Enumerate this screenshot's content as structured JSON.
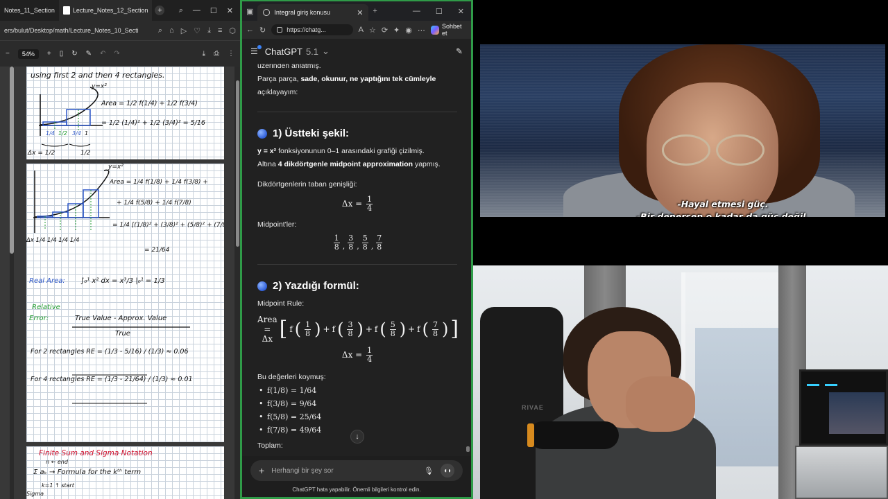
{
  "pdf_viewer": {
    "tabs": [
      {
        "label": "Notes_11_Section"
      },
      {
        "label": "Lecture_Notes_12_Section"
      }
    ],
    "address": "ers/bulut/Desktop/math/Lecture_Notes_10_Secti",
    "zoom": "54%",
    "page1": {
      "line1": "using first 2 and then 4 rectangles.",
      "curve_label": "y=x²",
      "area_eq1": "Area = 1/2 f(1/4) + 1/2 f(3/4)",
      "area_eq2": "= 1/2 (1/4)² + 1/2 (3/4)² = 5/16",
      "ticks": [
        "1/4",
        "1/2",
        "3/4",
        "1"
      ],
      "dx_label": "Δx = 1/2",
      "dx_label2": "1/2"
    },
    "page2": {
      "curve_label": "y=x²",
      "area_eq1": "Area = 1/4 f(1/8) + 1/4 f(3/8) +",
      "area_eq2": "+ 1/4 f(5/8) + 1/4 f(7/8)",
      "area_eq3": "= 1/4 [(1/8)² + (3/8)² + (5/8)² + (7/8)²]",
      "area_eq4": "= 21/64",
      "dx_row": "Δx  1/4  1/4  1/4  1/4",
      "real_area_label": "Real Area:",
      "real_area_eq": "∫₀¹ x² dx = x³/3 |₀¹ = 1/3",
      "relative_label": "Relative",
      "error_label": "Error:",
      "error_num": "True Value - Approx. Value",
      "error_den": "True",
      "re2": "For 2 rectangles RE = (1/3 - 5/16) / (1/3) ≈ 0.06",
      "re4": "For 4 rectangles RE = (1/3 - 21/64) / (1/3) ≈ 0.01"
    },
    "page3": {
      "title": "Finite Sum and Sigma Notation",
      "sigma_line": "Σ aₖ → Formula for the kᵗʰ term",
      "sigma_top": "n ← end",
      "sigma_bottom": "k=1 ↑ start",
      "sigma_word": "Sigma"
    }
  },
  "browser": {
    "tab_title": "Integral giriş konusu",
    "url": "https://chatg...",
    "sohbet_label": "Sohbet et"
  },
  "chatgpt": {
    "model": "ChatGPT",
    "version": "5.1",
    "intro_line1": "üzerinden anlatmış.",
    "intro_line2_pre": "Parça parça, ",
    "intro_line2_bold": "sade, okunur, ne yaptığını tek cümleyle",
    "intro_line3": "açıklayayım:",
    "section1_title": "1) Üstteki şekil:",
    "s1_p1_bold": "y = x²",
    "s1_p1_rest": " fonksiyonunun 0–1 arasındaki grafiği çizilmiş.",
    "s1_p2_pre": "Altına ",
    "s1_p2_bold": "4 dikdörtgenle midpoint approximation",
    "s1_p2_rest": " yapmış.",
    "s1_p3": "Dikdörtgenlerin taban genişliği:",
    "dx_lhs": "Δx =",
    "dx_num": "1",
    "dx_den": "4",
    "midpoints_label": "Midpoint'ler:",
    "midpoint_nums": [
      "1",
      "3",
      "5",
      "7"
    ],
    "midpoint_den": "8",
    "section2_title": "2) Yazdığı formül:",
    "rule_label": "Midpoint Rule:",
    "formula_lhs": "Area = Δx",
    "f_label": "f",
    "plus": "+",
    "values_label": "Bu değerleri koymuş:",
    "values": [
      "f(1/8) = 1/64",
      "f(3/8) = 9/64",
      "f(5/8) = 25/64",
      "f(7/8) = 49/64"
    ],
    "toplam_label": "Toplam:",
    "input_placeholder": "Herhangi bir şey sor",
    "disclaimer": "ChatGPT hata yapabilir. Önemli bilgileri kontrol edin."
  },
  "video": {
    "subtitle_line1": "-Hayal etmesi güç.",
    "subtitle_line2": "-Bir denersen o kadar da güç değil."
  },
  "webcam": {
    "chair_brand": "RIVAE"
  },
  "colors": {
    "green_border": "#2f9b48",
    "handwriting_red": "#d10f2c",
    "handwriting_blue": "#2d57c8",
    "handwriting_green": "#1d9a2c"
  }
}
